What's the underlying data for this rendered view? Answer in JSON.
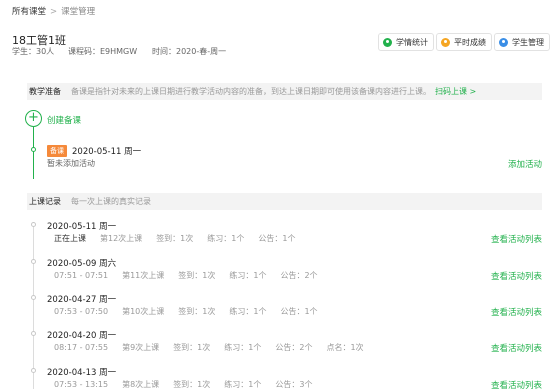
{
  "breadcrumb": {
    "root": "所有课堂",
    "sep": ">",
    "current": "课堂管理"
  },
  "course": {
    "title": "18工管1班",
    "students": "学生：30人",
    "code": "课程码：E9HMGW",
    "time": "时间：2020-春-周一"
  },
  "header_buttons": [
    {
      "label": "学情统计",
      "icon": "chart-icon",
      "color": "#22b14c"
    },
    {
      "label": "平时成绩",
      "icon": "score-icon",
      "color": "#f5a623"
    },
    {
      "label": "学生管理",
      "icon": "students-icon",
      "color": "#3a8ee6"
    }
  ],
  "prep": {
    "title": "教学准备",
    "desc": "备课是指针对未来的上课日期进行教学活动内容的准备，到达上课日期即可使用该备课内容进行上课。",
    "link": "扫码上课 >",
    "create_label": "创建备课",
    "item": {
      "tag": "备课",
      "date": "2020-05-11 周一",
      "status": "暂未添加活动",
      "action": "添加活动"
    }
  },
  "records": {
    "title": "上课记录",
    "subtitle": "每一次上课的真实记录",
    "link_label": "查看活动列表",
    "items": [
      {
        "date": "2020-05-11 周一",
        "time": "正在上课",
        "session": "第12次上课",
        "signin": "签到：1次",
        "practice": "练习：1个",
        "notice": "公告：1个",
        "rollcall": ""
      },
      {
        "date": "2020-05-09 周六",
        "time": "07:51 - 07:51",
        "session": "第11次上课",
        "signin": "签到：1次",
        "practice": "练习：1个",
        "notice": "公告：2个",
        "rollcall": ""
      },
      {
        "date": "2020-04-27 周一",
        "time": "07:53 - 07:50",
        "session": "第10次上课",
        "signin": "签到：1次",
        "practice": "练习：1个",
        "notice": "公告：1个",
        "rollcall": ""
      },
      {
        "date": "2020-04-20 周一",
        "time": "08:17 - 07:55",
        "session": "第9次上课",
        "signin": "签到：1次",
        "practice": "练习：1个",
        "notice": "公告：2个",
        "rollcall": "点名：1次"
      },
      {
        "date": "2020-04-13 周一",
        "time": "07:53 - 13:15",
        "session": "第8次上课",
        "signin": "签到：1次",
        "practice": "练习：1个",
        "notice": "公告：3个",
        "rollcall": ""
      }
    ]
  }
}
